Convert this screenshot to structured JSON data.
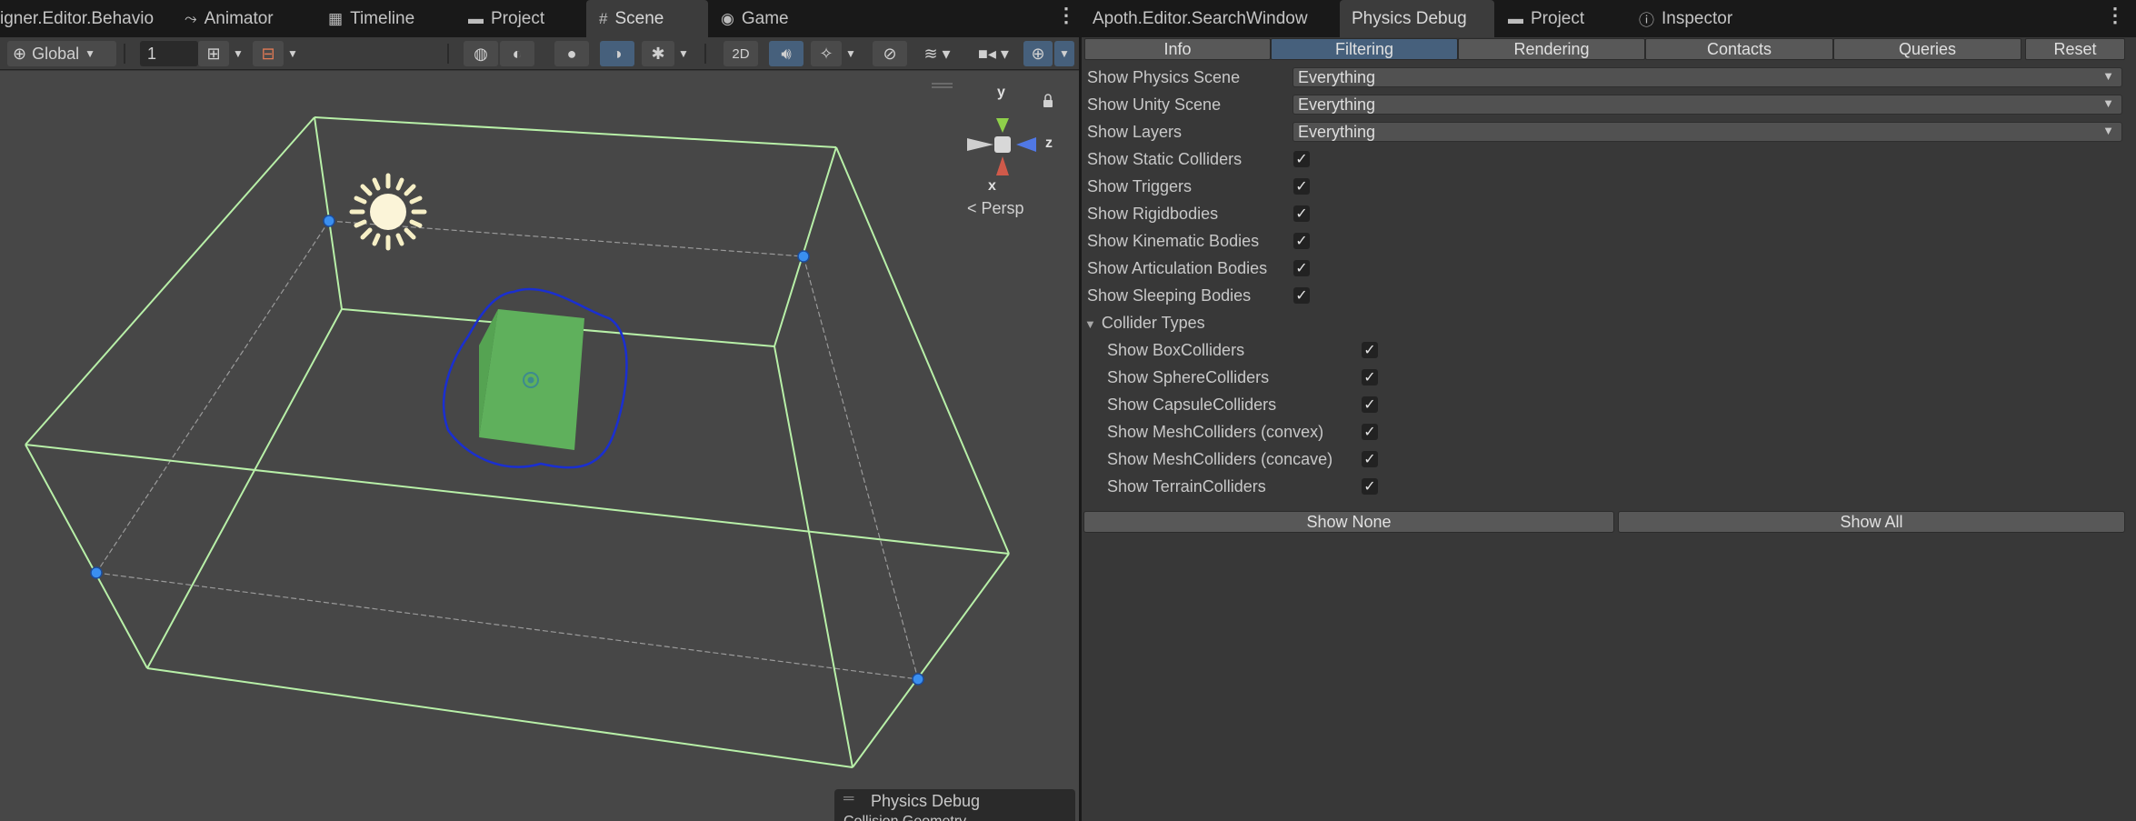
{
  "left_tabs": [
    {
      "label": "igner.Editor.Behavio",
      "icon": ""
    },
    {
      "label": "Animator",
      "icon": "animator-icon"
    },
    {
      "label": "Timeline",
      "icon": "timeline-icon"
    },
    {
      "label": "Project",
      "icon": "folder-icon"
    },
    {
      "label": "Scene",
      "icon": "grid-icon"
    },
    {
      "label": "Game",
      "icon": "gamepad-icon"
    }
  ],
  "right_tabs": [
    {
      "label": "Apoth.Editor.SearchWindow",
      "icon": ""
    },
    {
      "label": "Physics Debug",
      "icon": ""
    },
    {
      "label": "Project",
      "icon": "folder-icon"
    },
    {
      "label": "Inspector",
      "icon": "info-icon"
    }
  ],
  "scene_toolbar": {
    "pivot_rotation": "Global",
    "grid_value": "1"
  },
  "scene": {
    "orientation": {
      "y": "y",
      "z": "z",
      "x": "x",
      "projection": "< Persp"
    },
    "overlay_title": "Physics Debug",
    "overlay_subtitle": "Collision Geometry"
  },
  "physics_debug": {
    "subtabs": [
      "Info",
      "Filtering",
      "Rendering",
      "Contacts",
      "Queries"
    ],
    "reset_label": "Reset",
    "dropdown_rows": [
      {
        "label": "Show Physics Scene",
        "value": "Everything"
      },
      {
        "label": "Show Unity Scene",
        "value": "Everything"
      },
      {
        "label": "Show Layers",
        "value": "Everything"
      }
    ],
    "toggle_rows": [
      {
        "label": "Show Static Colliders",
        "checked": true
      },
      {
        "label": "Show Triggers",
        "checked": true
      },
      {
        "label": "Show Rigidbodies",
        "checked": true
      },
      {
        "label": "Show Kinematic Bodies",
        "checked": true
      },
      {
        "label": "Show Articulation Bodies",
        "checked": true
      },
      {
        "label": "Show Sleeping Bodies",
        "checked": true
      }
    ],
    "collider_types_label": "Collider Types",
    "collider_rows": [
      {
        "label": "Show BoxColliders",
        "checked": true
      },
      {
        "label": "Show SphereColliders",
        "checked": true
      },
      {
        "label": "Show CapsuleColliders",
        "checked": true
      },
      {
        "label": "Show MeshColliders (convex)",
        "checked": true
      },
      {
        "label": "Show MeshColliders (concave)",
        "checked": true
      },
      {
        "label": "Show TerrainColliders",
        "checked": true
      }
    ],
    "show_none_label": "Show None",
    "show_all_label": "Show All"
  },
  "colors": {
    "selected_tab": "#46607c",
    "wire_box": "#b8f0a8",
    "cube": "#5fb05c",
    "outline": "#1a2fd0"
  }
}
